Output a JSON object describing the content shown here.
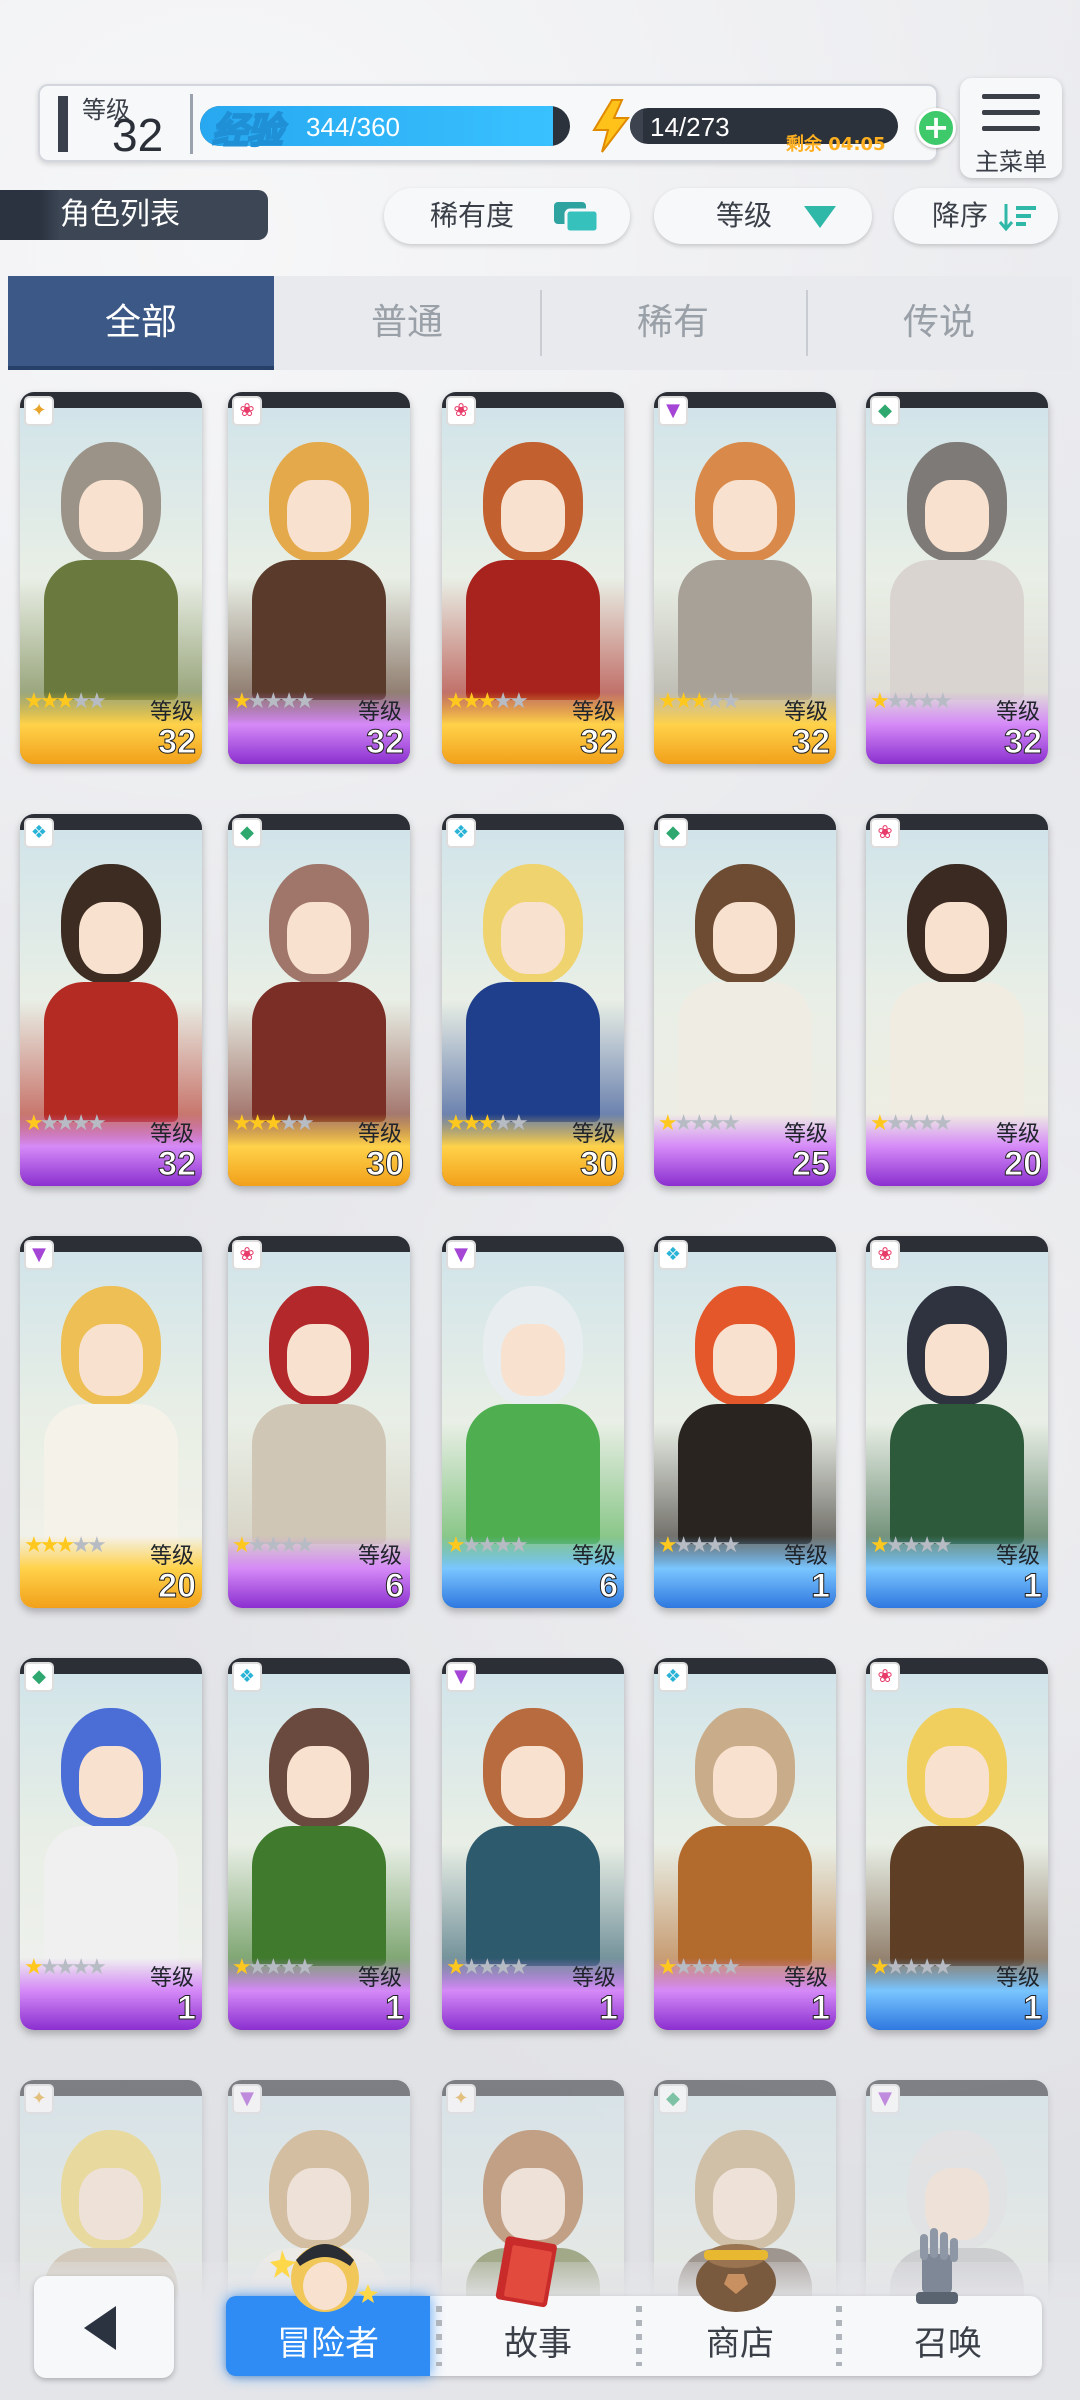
{
  "header": {
    "level_label": "等级",
    "level_value": "32",
    "exp_label": "经验",
    "exp_value": "344/360",
    "exp_progress": 0.955,
    "stamina_value": "14/273",
    "stamina_progress": 0.05,
    "stamina_timer": "剩余 04:05",
    "main_menu_label": "主菜单"
  },
  "filter": {
    "list_title": "角色列表",
    "rarity_label": "稀有度",
    "level_label": "等级",
    "order_label": "降序"
  },
  "tabs": [
    "全部",
    "普通",
    "稀有",
    "传说"
  ],
  "card_level_label": "等级",
  "characters": [
    {
      "level": "32",
      "stars": 3,
      "element": "earth",
      "frame": "gold",
      "hair": "#9b9388",
      "cloth": "#6a7a3e"
    },
    {
      "level": "32",
      "stars": 1,
      "element": "fire",
      "frame": "purple",
      "hair": "#e4a94a",
      "cloth": "#5a3a2a"
    },
    {
      "level": "32",
      "stars": 3,
      "element": "fire",
      "frame": "gold",
      "hair": "#c2602f",
      "cloth": "#a8231d"
    },
    {
      "level": "32",
      "stars": 3,
      "element": "dark",
      "frame": "gold",
      "hair": "#d98a4a",
      "cloth": "#a7a198"
    },
    {
      "level": "32",
      "stars": 1,
      "element": "wind",
      "frame": "purple",
      "hair": "#7e7a78",
      "cloth": "#d9d4cf"
    },
    {
      "level": "32",
      "stars": 1,
      "element": "water",
      "frame": "purple",
      "hair": "#3d2c22",
      "cloth": "#b32b22"
    },
    {
      "level": "30",
      "stars": 3,
      "element": "wind",
      "frame": "gold",
      "hair": "#a0766b",
      "cloth": "#7a2e25"
    },
    {
      "level": "30",
      "stars": 3,
      "element": "water",
      "frame": "gold",
      "hair": "#efd36e",
      "cloth": "#1f3f8c"
    },
    {
      "level": "25",
      "stars": 1,
      "element": "wind",
      "frame": "purple",
      "hair": "#6e4b33",
      "cloth": "#efece4"
    },
    {
      "level": "20",
      "stars": 1,
      "element": "fire",
      "frame": "purple",
      "hair": "#3b2a22",
      "cloth": "#f0ece2"
    },
    {
      "level": "20",
      "stars": 3,
      "element": "dark",
      "frame": "gold",
      "hair": "#edbf55",
      "cloth": "#f5f2ea"
    },
    {
      "level": "6",
      "stars": 1,
      "element": "fire",
      "frame": "purple",
      "hair": "#b3282b",
      "cloth": "#cfc6b6"
    },
    {
      "level": "6",
      "stars": 1,
      "element": "dark",
      "frame": "blue",
      "hair": "#e8edf0",
      "cloth": "#4fae4f"
    },
    {
      "level": "1",
      "stars": 1,
      "element": "water",
      "frame": "blue",
      "hair": "#e3572a",
      "cloth": "#2a2420"
    },
    {
      "level": "1",
      "stars": 1,
      "element": "fire",
      "frame": "blue",
      "hair": "#2f3340",
      "cloth": "#2d5a3a"
    },
    {
      "level": "1",
      "stars": 1,
      "element": "wind",
      "frame": "purple",
      "hair": "#4a6ed6",
      "cloth": "#f0f0f0"
    },
    {
      "level": "1",
      "stars": 1,
      "element": "water",
      "frame": "purple",
      "hair": "#6a4a3e",
      "cloth": "#3f7a2d"
    },
    {
      "level": "1",
      "stars": 1,
      "element": "dark",
      "frame": "purple",
      "hair": "#b86b3e",
      "cloth": "#2d5a6d"
    },
    {
      "level": "1",
      "stars": 1,
      "element": "water",
      "frame": "purple",
      "hair": "#c9ad8a",
      "cloth": "#b36a2d"
    },
    {
      "level": "1",
      "stars": 1,
      "element": "fire",
      "frame": "blue",
      "hair": "#f0cf5e",
      "cloth": "#5e3e25"
    },
    {
      "level": "",
      "stars": 0,
      "element": "earth",
      "frame": "none",
      "hair": "#f0d467",
      "cloth": "#c7b79a",
      "faded": true
    },
    {
      "level": "",
      "stars": 0,
      "element": "dark",
      "frame": "none",
      "hair": "#c9a26a",
      "cloth": "#f5f2ea",
      "faded": true
    },
    {
      "level": "",
      "stars": 0,
      "element": "earth",
      "frame": "none",
      "hair": "#a86b3a",
      "cloth": "#6e7d3e",
      "faded": true
    },
    {
      "level": "",
      "stars": 0,
      "element": "wind",
      "frame": "none",
      "hair": "#c4a677",
      "cloth": "#6a5a4a",
      "faded": true
    },
    {
      "level": "",
      "stars": 0,
      "element": "dark",
      "frame": "none",
      "hair": "#e3e3e3",
      "cloth": "#bfbfbf",
      "faded": true
    }
  ],
  "bottom_nav": {
    "items": [
      "冒险者",
      "故事",
      "商店",
      "召唤"
    ]
  },
  "colors": {
    "accent": "#2f8cf4",
    "tab_active": "#3c5886",
    "frame_gold": "#f2b11f",
    "frame_purple": "#9b3fd6",
    "frame_blue": "#3a8ee8",
    "exp_fill": "#27a8f0",
    "stamina_plus": "#3ec96a"
  },
  "icons": {
    "level_bolt": "lightning-bolt-icon",
    "rarity": "cards-stack-icon",
    "level_sort": "triangle-down-icon",
    "order": "sort-descending-icon",
    "back": "triangle-left-icon"
  }
}
